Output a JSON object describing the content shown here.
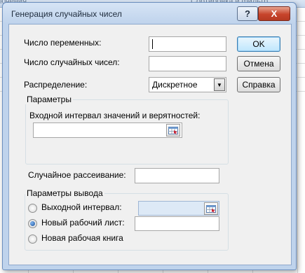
{
  "background": {
    "ribbon_left": "ючения",
    "ribbon_right": "Сортировка и фильтр"
  },
  "dialog": {
    "title": "Генерация случайных чисел",
    "help_label": "?",
    "close_label": "X",
    "num_variables_label": "Число переменных:",
    "num_variables_value": "",
    "num_random_label": "Число случайных чисел:",
    "num_random_value": "",
    "distribution_label": "Распределение:",
    "distribution_value": "Дискретное",
    "parameters_group": "Параметры",
    "input_range_label": "Входной интервал значений и верятностей:",
    "input_range_value": "",
    "random_seed_label": "Случайное рассеивание:",
    "random_seed_value": "",
    "output_group": "Параметры вывода",
    "output_options": [
      {
        "label": "Выходной интервал:",
        "checked": false
      },
      {
        "label": "Новый рабочий лист:",
        "checked": true
      },
      {
        "label": "Новая рабочая книга",
        "checked": false
      }
    ],
    "output_range_value": "",
    "new_sheet_value": "",
    "ok_label": "OK",
    "cancel_label": "Отмена",
    "help_button_label": "Справка"
  },
  "colors": {
    "dialog_frame": "#bfd3ec",
    "client_bg": "#f0f0f0",
    "close_button": "#c7442b"
  }
}
